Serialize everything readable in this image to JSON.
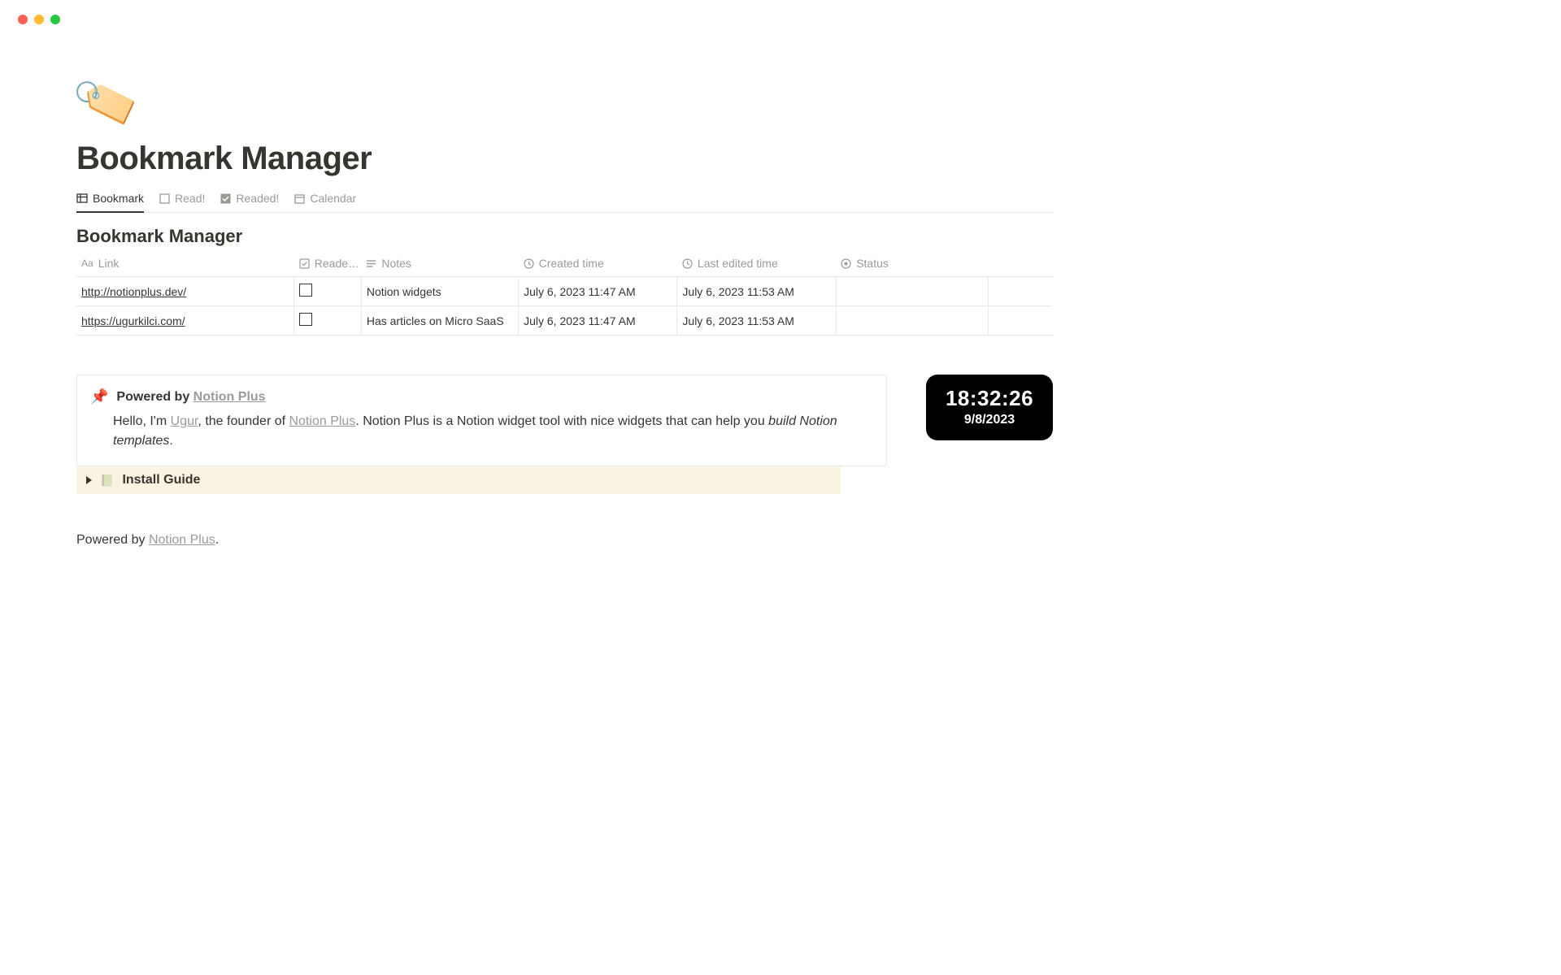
{
  "page": {
    "icon": "🏷️",
    "title": "Bookmark Manager",
    "section_title": "Bookmark Manager"
  },
  "tabs": [
    {
      "label": "Bookmark",
      "icon": "table"
    },
    {
      "label": "Read!",
      "icon": "checkbox-empty"
    },
    {
      "label": "Readed!",
      "icon": "checkbox-checked"
    },
    {
      "label": "Calendar",
      "icon": "calendar"
    }
  ],
  "columns": {
    "link": "Link",
    "readed": "Reade…",
    "notes": "Notes",
    "created": "Created time",
    "lastedited": "Last edited time",
    "status": "Status"
  },
  "rows": [
    {
      "link": "http://notionplus.dev/",
      "readed": false,
      "notes": "Notion widgets",
      "created": "July 6, 2023 11:47 AM",
      "lastedited": "July 6, 2023 11:53 AM",
      "status": ""
    },
    {
      "link": "https://ugurkilci.com/",
      "readed": false,
      "notes": "Has articles on Micro SaaS",
      "created": "July 6, 2023 11:47 AM",
      "lastedited": "July 6, 2023 11:53 AM",
      "status": ""
    }
  ],
  "callout": {
    "icon": "📌",
    "prefix": "Powered by ",
    "brand": "Notion Plus",
    "body_hello": "Hello, I'm ",
    "body_name": "Ugur",
    "body_mid": ", the founder of ",
    "body_brand2": "Notion Plus",
    "body_after": ". Notion Plus is a Notion widget tool with nice widgets that can help you ",
    "body_italic": "build Notion templates",
    "body_end": "."
  },
  "install": {
    "icon": "📗",
    "label": "Install Guide"
  },
  "clock": {
    "time": "18:32:26",
    "date": "9/8/2023"
  },
  "footer": {
    "prefix": "Powered by ",
    "brand": "Notion Plus",
    "suffix": "."
  }
}
